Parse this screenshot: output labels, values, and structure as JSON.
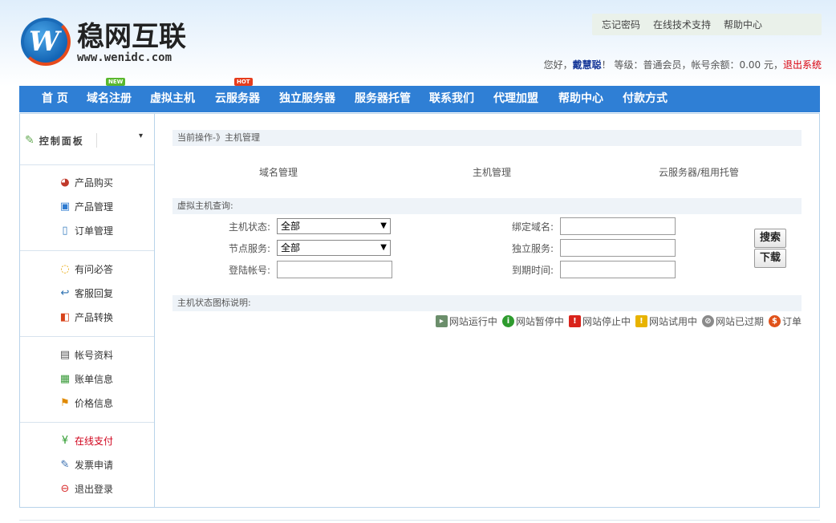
{
  "brand": {
    "logo_text_cn": "稳网互联",
    "logo_text_en": "www.wenidc.com",
    "logo_mark": "W"
  },
  "top_links": [
    "忘记密码",
    "在线技术支持",
    "帮助中心"
  ],
  "user_bar": {
    "greeting_prefix": "您好，",
    "username": "戴慧聪",
    "greeting_suffix": "！ 等级：普通会员，帐号余额：0.00 元，",
    "logout": "退出系统"
  },
  "nav": {
    "items": [
      "首 页",
      "域名注册",
      "虚拟主机",
      "云服务器",
      "独立服务器",
      "服务器托管",
      "联系我们",
      "代理加盟",
      "帮助中心",
      "付款方式"
    ],
    "badge_new": "NEW",
    "badge_hot": "HOT"
  },
  "sidebar": {
    "title": "控制面板",
    "dropdown_arrow": "▾",
    "groups": [
      [
        {
          "label": "产品购买",
          "icon": "cart-icon"
        },
        {
          "label": "产品管理",
          "icon": "box-icon"
        },
        {
          "label": "订单管理",
          "icon": "document-icon"
        }
      ],
      [
        {
          "label": "有问必答",
          "icon": "chat-icon"
        },
        {
          "label": "客服回复",
          "icon": "reply-icon"
        },
        {
          "label": "产品转换",
          "icon": "convert-icon"
        }
      ],
      [
        {
          "label": "帐号资料",
          "icon": "id-card-icon"
        },
        {
          "label": "账单信息",
          "icon": "bill-icon"
        },
        {
          "label": "价格信息",
          "icon": "flag-icon"
        }
      ],
      [
        {
          "label": "在线支付",
          "icon": "yen-icon"
        },
        {
          "label": "发票申请",
          "icon": "invoice-icon"
        },
        {
          "label": "退出登录",
          "icon": "logout-icon"
        }
      ]
    ]
  },
  "content": {
    "breadcrumb": "当前操作-》主机管理",
    "tabs": [
      "域名管理",
      "主机管理",
      "云服务器/租用托管"
    ],
    "query_title": "虚拟主机查询:",
    "fields": {
      "host_status_label": "主机状态:",
      "host_status_value": "全部",
      "node_label": "节点服务:",
      "node_value": "全部",
      "login_label": "登陆帐号:",
      "bind_domain_label": "绑定域名:",
      "dedicated_label": "独立服务:",
      "expire_label": "到期时间:"
    },
    "buttons": {
      "search": "搜索",
      "download": "下载"
    },
    "legend_title": "主机状态图标说明:",
    "legend": [
      {
        "label": "网站运行中",
        "color": "#6b8e6b"
      },
      {
        "label": "网站暂停中",
        "color": "#2e9b2e"
      },
      {
        "label": "网站停止中",
        "color": "#d9231b"
      },
      {
        "label": "网站试用中",
        "color": "#e8b300"
      },
      {
        "label": "网站已过期",
        "color": "#8a8a8a"
      },
      {
        "label": "订单",
        "color": "#e0521a"
      }
    ]
  }
}
